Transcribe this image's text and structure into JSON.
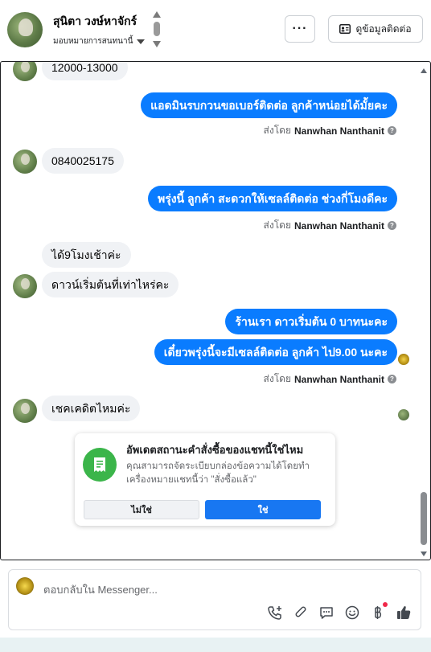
{
  "header": {
    "name": "สุนิตา วงษ์หาจักร์",
    "assign_label": "มอบหมายการสนทนานี้",
    "more_label": "···",
    "contact_label": "ดูข้อมูลติดต่อ"
  },
  "messages": {
    "m1": "12000-13000",
    "m2": "แอดมินรบกวนขอเบอร์ติดต่อ ลูกค้าหน่อยได้มั้ยคะ",
    "m3": "0840025175",
    "m4": "พรุ่งนี้ ลูกค้า สะดวกให้เซลล์ติดต่อ ช่วงกี่โมงดีคะ",
    "m5": "ได้9โมงเช้าค่ะ",
    "m6": "ดาวน์เริ่มต้นที่เท่าไหร่คะ",
    "m7": "ร้านเรา ดาวเริ่มต้น 0 บาทนะคะ",
    "m8": "เดี๋ยวพรุ่งนี้จะมีเซลล์ติดต่อ ลูกค้า ไป9.00 นะคะ",
    "m9": "เชคเคดิตไหมค่ะ"
  },
  "sent_by": {
    "prefix": "ส่งโดย",
    "name": "Nanwhan Nanthanit",
    "help": "?"
  },
  "card": {
    "title": "อัพเดตสถานะคำสั่งซื้อของแชทนี้ใช่ไหม",
    "body": "คุณสามารถจัดระเบียบกล่องข้อความได้โดยทำเครื่องหมายแชทนี้ว่า \"สั่งซื้อแล้ว\"",
    "no_label": "ไม่ใช่",
    "yes_label": "ใช่"
  },
  "composer": {
    "placeholder": "ตอบกลับใน Messenger..."
  },
  "icons": [
    "phone-plus-icon",
    "paperclip-icon",
    "saved-reply-icon",
    "emoji-icon",
    "baht-icon",
    "thumbs-up-icon"
  ],
  "colors": {
    "outgoing": "#0a7cff",
    "incoming": "#f0f2f5",
    "primary_button": "#1877f2",
    "card_icon": "#3bb54a"
  }
}
